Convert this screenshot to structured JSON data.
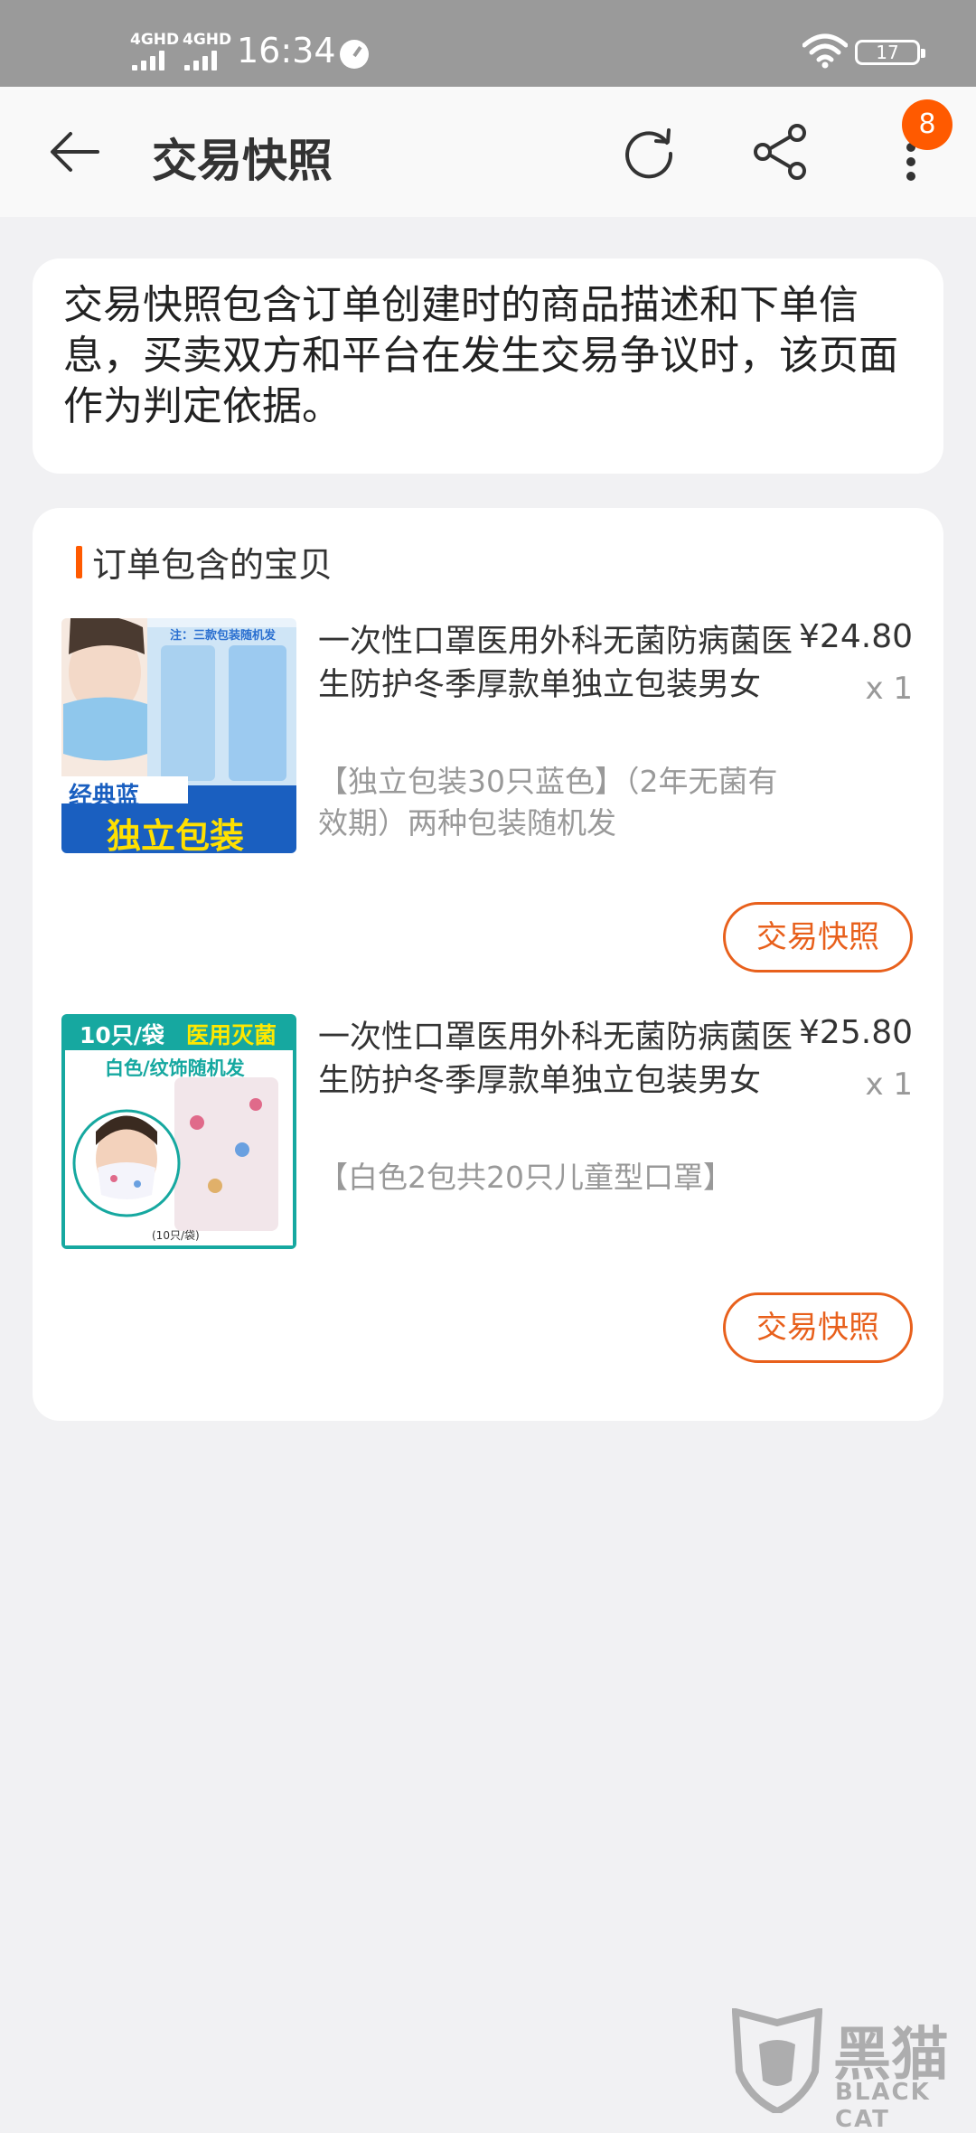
{
  "status_bar": {
    "network_1": "4GHD",
    "network_2": "4GHD",
    "time": "16:34",
    "battery": "17"
  },
  "header": {
    "title": "交易快照",
    "notification_count": "8",
    "icons": [
      "back-arrow-icon",
      "refresh-icon",
      "share-icon",
      "more-icon"
    ]
  },
  "info": {
    "text": "交易快照包含订单创建时的商品描述和下单信息，买卖双方和平台在发生交易争议时，该页面作为判定依据。"
  },
  "goods": {
    "section_title": "订单包含的宝贝",
    "items": [
      {
        "name": "一次性口罩医用外科无菌防病菌医生防护冬季厚款单独立包装男女",
        "spec": "【独立包装30只蓝色】（2年无菌有效期）两种包装随机发",
        "price": "¥24.80",
        "qty": "x 1",
        "snapshot_label": "交易快照",
        "image_text": {
          "note": "注：三款包装随机发",
          "tag1": "经典蓝",
          "tag2": "独立包装"
        }
      },
      {
        "name": "一次性口罩医用外科无菌防病菌医生防护冬季厚款单独立包装男女",
        "spec": "【白色2包共20只儿童型口罩】",
        "price": "¥25.80",
        "qty": "x 1",
        "snapshot_label": "交易快照",
        "image_text": {
          "top1": "10只/袋",
          "top2": "医用灭菌",
          "sub": "白色/纹饰随机发",
          "foot": "(10只/袋)"
        }
      }
    ]
  },
  "watermark": {
    "cn": "黑猫",
    "en": "BLACK CAT"
  },
  "colors": {
    "accent": "#ff5a00",
    "button_border": "#e8601c",
    "status_bar": "#9a9a9a",
    "background": "#f1f1f3"
  }
}
